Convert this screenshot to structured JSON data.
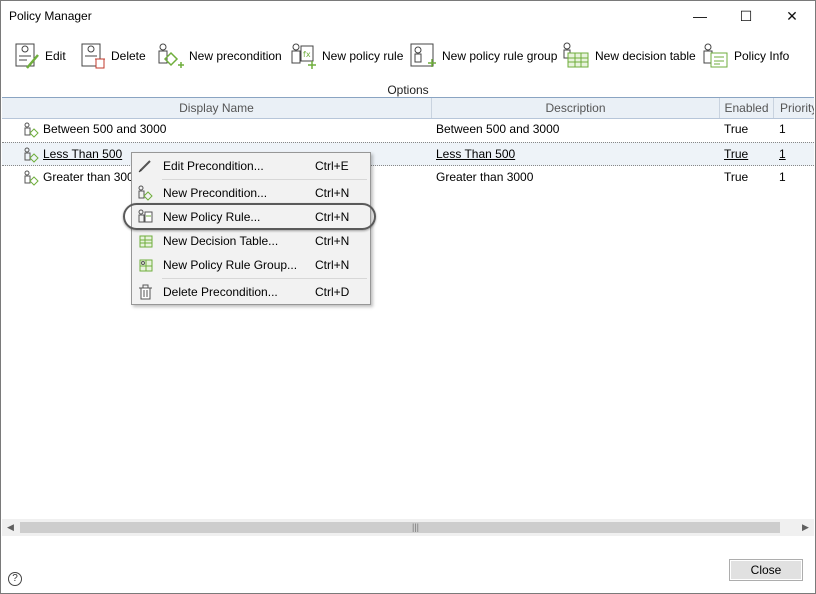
{
  "window": {
    "title": "Policy Manager",
    "minimize": "—",
    "maximize": "☐",
    "close": "✕"
  },
  "toolbar": {
    "items": [
      {
        "label": "Edit",
        "icon": "edit-document-icon"
      },
      {
        "label": "Delete",
        "icon": "delete-document-icon"
      },
      {
        "label": "New precondition",
        "icon": "new-precondition-icon"
      },
      {
        "label": "New policy rule",
        "icon": "new-policy-rule-icon"
      },
      {
        "label": "New policy rule group",
        "icon": "new-policy-rule-group-icon"
      },
      {
        "label": "New decision table",
        "icon": "new-decision-table-icon"
      },
      {
        "label": "Policy Info",
        "icon": "policy-info-icon"
      }
    ],
    "group_label": "Options"
  },
  "grid": {
    "columns": [
      "Display Name",
      "Description",
      "Enabled",
      "Priority"
    ],
    "rows": [
      {
        "name": "Between 500 and 3000",
        "description": "Between 500 and 3000",
        "enabled": "True",
        "priority": "1"
      },
      {
        "name": "Less Than 500",
        "description": "Less Than 500",
        "enabled": "True",
        "priority": "1"
      },
      {
        "name": "Greater than 3000",
        "description": "Greater than 3000",
        "enabled": "True",
        "priority": "1"
      }
    ],
    "selected_row": 1
  },
  "context_menu": {
    "items": [
      {
        "label": "Edit Precondition...",
        "shortcut": "Ctrl+E",
        "icon": "pencil-icon"
      },
      {
        "label": "New Precondition...",
        "shortcut": "Ctrl+N",
        "icon": "precondition-icon"
      },
      {
        "label": "New Policy Rule...",
        "shortcut": "Ctrl+N",
        "icon": "policy-rule-icon"
      },
      {
        "label": "New Decision Table...",
        "shortcut": "Ctrl+N",
        "icon": "decision-table-icon"
      },
      {
        "label": "New Policy Rule Group...",
        "shortcut": "Ctrl+N",
        "icon": "policy-rule-group-icon"
      },
      {
        "label": "Delete Precondition...",
        "shortcut": "Ctrl+D",
        "icon": "trash-icon"
      }
    ],
    "highlighted_item": "New Policy Rule..."
  },
  "footer": {
    "help": "?",
    "close_button": "Close"
  },
  "colors": {
    "accent_green": "#6fae3c",
    "icon_gray": "#555555",
    "header_bg": "#eaf0f6"
  }
}
